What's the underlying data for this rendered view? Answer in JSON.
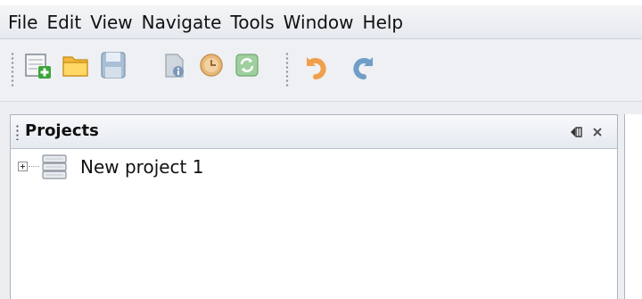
{
  "menubar": {
    "items": [
      {
        "label": "File"
      },
      {
        "label": "Edit"
      },
      {
        "label": "View"
      },
      {
        "label": "Navigate"
      },
      {
        "label": "Tools"
      },
      {
        "label": "Window"
      },
      {
        "label": "Help"
      }
    ]
  },
  "toolbar": {
    "buttons": [
      {
        "icon": "new-project-icon"
      },
      {
        "icon": "open-folder-icon"
      },
      {
        "icon": "save-icon"
      },
      {
        "icon": "properties-icon"
      },
      {
        "icon": "clock-icon"
      },
      {
        "icon": "refresh-icon"
      },
      {
        "icon": "undo-icon"
      },
      {
        "icon": "redo-icon"
      }
    ]
  },
  "projects_panel": {
    "title": "Projects",
    "tree": [
      {
        "label": "New project 1",
        "icon": "database-icon",
        "expanded": false
      }
    ]
  }
}
